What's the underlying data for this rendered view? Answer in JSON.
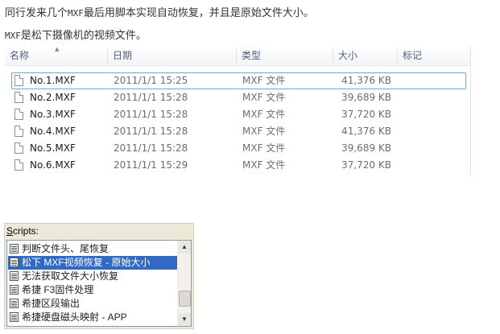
{
  "intro": {
    "line1_before": "同行发来几个",
    "line1_mono": "MXF",
    "line1_after": "最后用脚本实现自动恢复，并且是原始文件大小。",
    "line2_mono": "MXF",
    "line2_after": "是松下摄像机的视频文件。"
  },
  "explorer": {
    "columns": [
      "名称",
      "日期",
      "类型",
      "大小",
      "标记"
    ],
    "files": [
      {
        "name": "No.1.MXF",
        "date": "2011/1/1 15:25",
        "type": "MXF 文件",
        "size": "41,376 KB"
      },
      {
        "name": "No.2.MXF",
        "date": "2011/1/1 15:28",
        "type": "MXF 文件",
        "size": "39,689 KB"
      },
      {
        "name": "No.3.MXF",
        "date": "2011/1/1 15:28",
        "type": "MXF 文件",
        "size": "37,720 KB"
      },
      {
        "name": "No.4.MXF",
        "date": "2011/1/1 15:28",
        "type": "MXF 文件",
        "size": "41,376 KB"
      },
      {
        "name": "No.5.MXF",
        "date": "2011/1/1 15:28",
        "type": "MXF 文件",
        "size": "39,689 KB"
      },
      {
        "name": "No.6.MXF",
        "date": "2011/1/1 15:29",
        "type": "MXF 文件",
        "size": "37,720 KB"
      }
    ]
  },
  "scripts": {
    "label_first": "S",
    "label_rest": "cripts:",
    "items": [
      "判断文件头、尾恢复",
      "松下 MXF视频恢复 - 原始大小",
      "无法获取文件大小恢复",
      "希捷 F3固件处理",
      "希捷区段输出",
      "希捷硬盘磁头映射 - APP"
    ],
    "selected_index": 1
  },
  "colors": {
    "selection": "#316ac5",
    "header_text": "#4d6082",
    "row_focus_border": "#7da2ce"
  },
  "icons": {
    "file": "file-icon",
    "script": "script-icon",
    "scroll_up": "scroll-up-arrow-icon",
    "scroll_down": "scroll-down-arrow-icon"
  }
}
